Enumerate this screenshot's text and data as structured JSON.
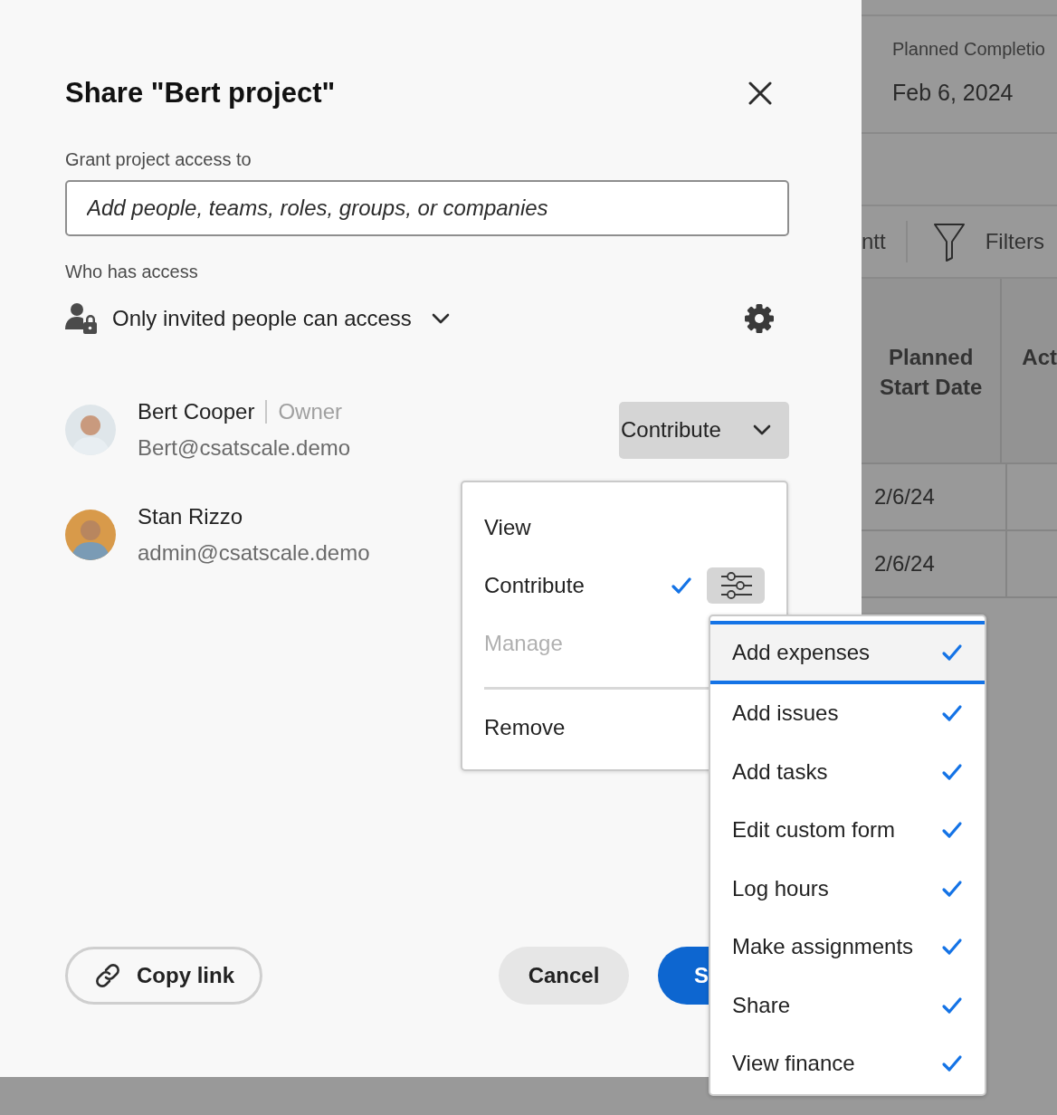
{
  "dialog": {
    "title": "Share \"Bert project\"",
    "grant_label": "Grant project access to",
    "search": {
      "placeholder": "Add people, teams, roles, groups, or companies"
    },
    "who_label": "Who has access",
    "access_setting": "Only invited people can access",
    "people": [
      {
        "name": "Bert Cooper",
        "role": "Owner",
        "email": "Bert@csatscale.demo",
        "permission": "Contribute"
      },
      {
        "name": "Stan Rizzo",
        "email": "admin@csatscale.demo"
      }
    ],
    "footer": {
      "copy_link": "Copy link",
      "cancel": "Cancel",
      "primary": "S"
    }
  },
  "permission_menu": {
    "items": [
      {
        "label": "View",
        "selected": false,
        "disabled": false
      },
      {
        "label": "Contribute",
        "selected": true,
        "disabled": false
      },
      {
        "label": "Manage",
        "selected": false,
        "disabled": true
      }
    ],
    "remove": "Remove"
  },
  "permission_submenu": {
    "items": [
      {
        "label": "Add expenses",
        "checked": true,
        "focused": true
      },
      {
        "label": "Add issues",
        "checked": true,
        "focused": false
      },
      {
        "label": "Add tasks",
        "checked": true,
        "focused": false
      },
      {
        "label": "Edit custom form",
        "checked": true,
        "focused": false
      },
      {
        "label": "Log hours",
        "checked": true,
        "focused": false
      },
      {
        "label": "Make assignments",
        "checked": true,
        "focused": false
      },
      {
        "label": "Share",
        "checked": true,
        "focused": false
      },
      {
        "label": "View finance",
        "checked": true,
        "focused": false
      }
    ]
  },
  "background": {
    "planned_completion_label": "Planned Completio",
    "planned_completion_value": "Feb 6, 2024",
    "toolbar": [
      "ntt",
      "Filters"
    ],
    "table": {
      "columns": [
        "Planned Start Date",
        "Act"
      ],
      "rows": [
        {
          "cells": [
            "2/6/24"
          ]
        },
        {
          "cells": [
            "2/6/24"
          ]
        }
      ]
    }
  }
}
